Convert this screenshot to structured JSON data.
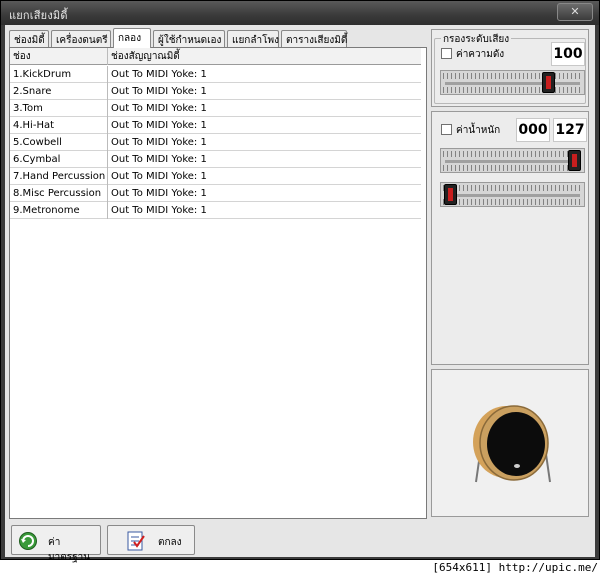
{
  "window": {
    "title": "แยกเสียงมิดี้",
    "close_label": "✕"
  },
  "tabs": [
    {
      "label": "ช่องมิดี้",
      "active": false
    },
    {
      "label": "เครื่องดนตรี",
      "active": false
    },
    {
      "label": "กลอง",
      "active": true
    },
    {
      "label": "ผู้ใช้กำหนดเอง",
      "active": false
    },
    {
      "label": "แยกลำโพง",
      "active": false
    },
    {
      "label": "ตารางเสียงมิดี้",
      "active": false
    }
  ],
  "table": {
    "columns": [
      "ช่อง",
      "ช่องสัญญาณมิดี้"
    ],
    "rows": [
      [
        "1.KickDrum",
        "Out To MIDI Yoke:  1"
      ],
      [
        "2.Snare",
        "Out To MIDI Yoke:  1"
      ],
      [
        "3.Tom",
        "Out To MIDI Yoke:  1"
      ],
      [
        "4.Hi-Hat",
        "Out To MIDI Yoke:  1"
      ],
      [
        "5.Cowbell",
        "Out To MIDI Yoke:  1"
      ],
      [
        "6.Cymbal",
        "Out To MIDI Yoke:  1"
      ],
      [
        "7.Hand Percussion",
        "Out To MIDI Yoke:  1"
      ],
      [
        "8.Misc Percussion",
        "Out To MIDI Yoke:  1"
      ],
      [
        "9.Metronome",
        "Out To MIDI Yoke:  1"
      ]
    ]
  },
  "volume_filter": {
    "group_label": "กรองระดับเสียง",
    "checkbox_label": "ค่าความดัง",
    "checked": false,
    "value": "100",
    "slider_level": 0.79
  },
  "velocity_filter": {
    "checkbox_label": "ค่าน้ำหนัก",
    "checked": false,
    "min_value": "000",
    "max_value": "127",
    "max_slider_level": 1.0,
    "min_slider_level": 0.0
  },
  "buttons": {
    "default_label": "ค่ามาตรฐาน",
    "ok_label": "ตกลง"
  },
  "status_text": "[654x611] http://upic.me/",
  "colors": {
    "thumb_indicator": "#c81e1e",
    "drum_rim": "#c68a3c"
  },
  "icons": {
    "default_button": "refresh-arrow-icon",
    "ok_button": "checklist-icon"
  }
}
